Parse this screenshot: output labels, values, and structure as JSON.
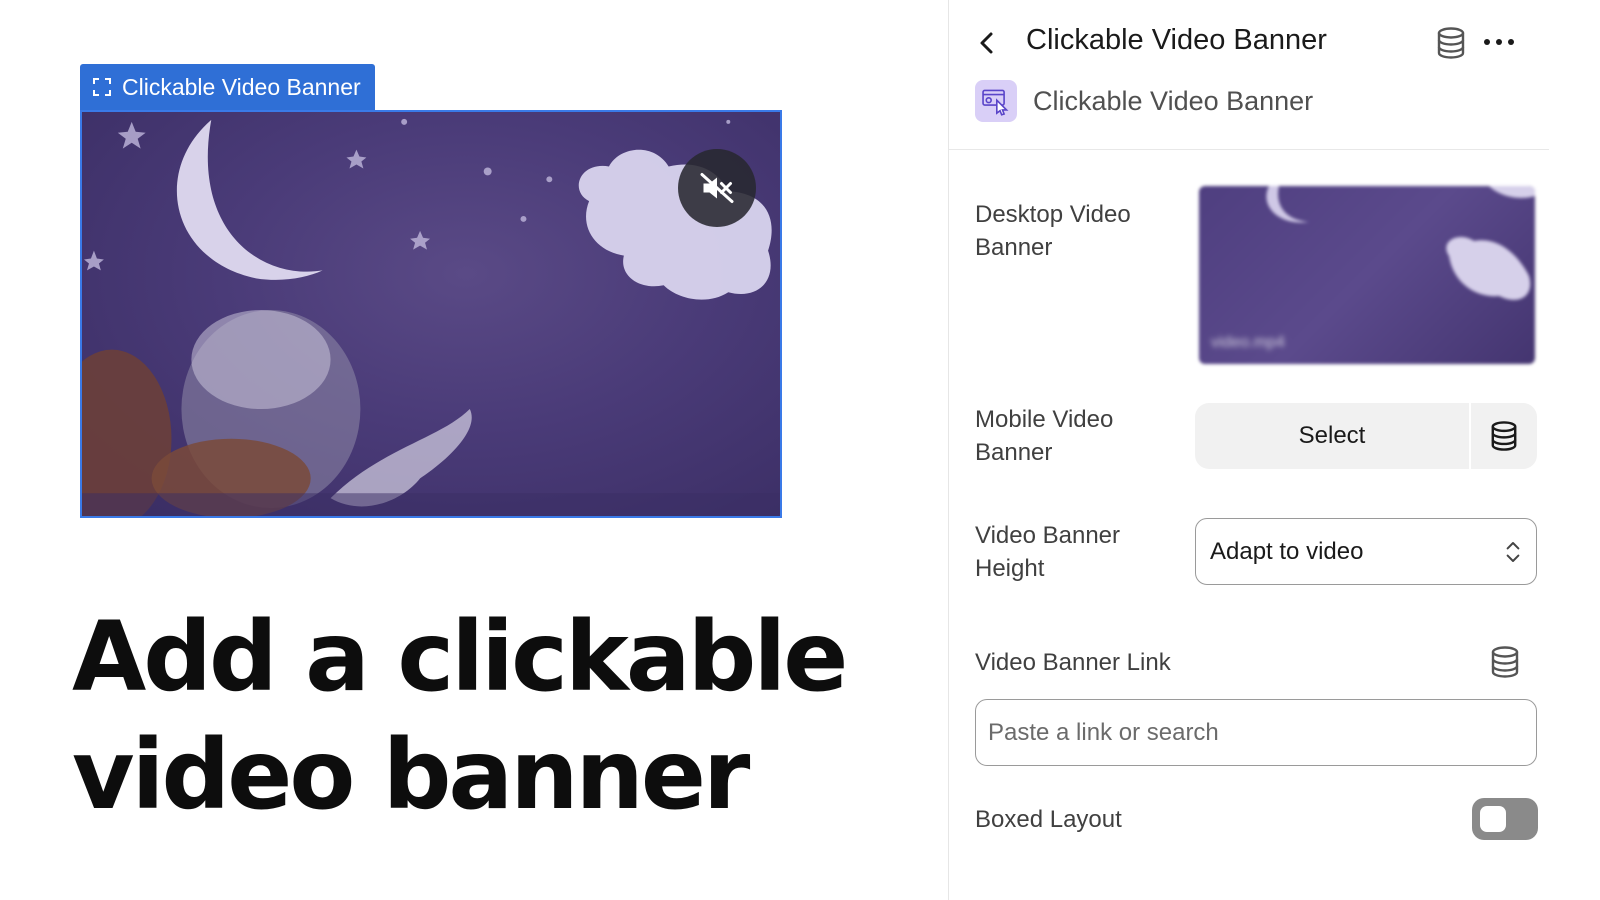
{
  "preview": {
    "tag_label": "Clickable Video Banner",
    "tag_icon": "frame-corners-icon",
    "mute_icon": "speaker-muted-icon"
  },
  "headline": {
    "line1": "Add a clickable",
    "line2": "video banner"
  },
  "panel": {
    "title": "Clickable Video Banner",
    "app_name": "Clickable Video Banner",
    "fields": {
      "desktop_video_label_1": "Desktop Video",
      "desktop_video_label_2": "Banner",
      "mobile_video_label_1": "Mobile Video",
      "mobile_video_label_2": "Banner",
      "select_label": "Select",
      "height_label_1": "Video Banner",
      "height_label_2": "Height",
      "height_value": "Adapt to video",
      "link_label": "Video Banner Link",
      "link_placeholder": "Paste a link or search",
      "boxed_layout_label": "Boxed Layout",
      "boxed_layout_on": false
    }
  },
  "colors": {
    "accent_blue": "#2f6fd6",
    "video_purple": "#4a3b78",
    "app_icon_bg": "#d9cff7",
    "toggle_off": "#8a8a8a"
  }
}
